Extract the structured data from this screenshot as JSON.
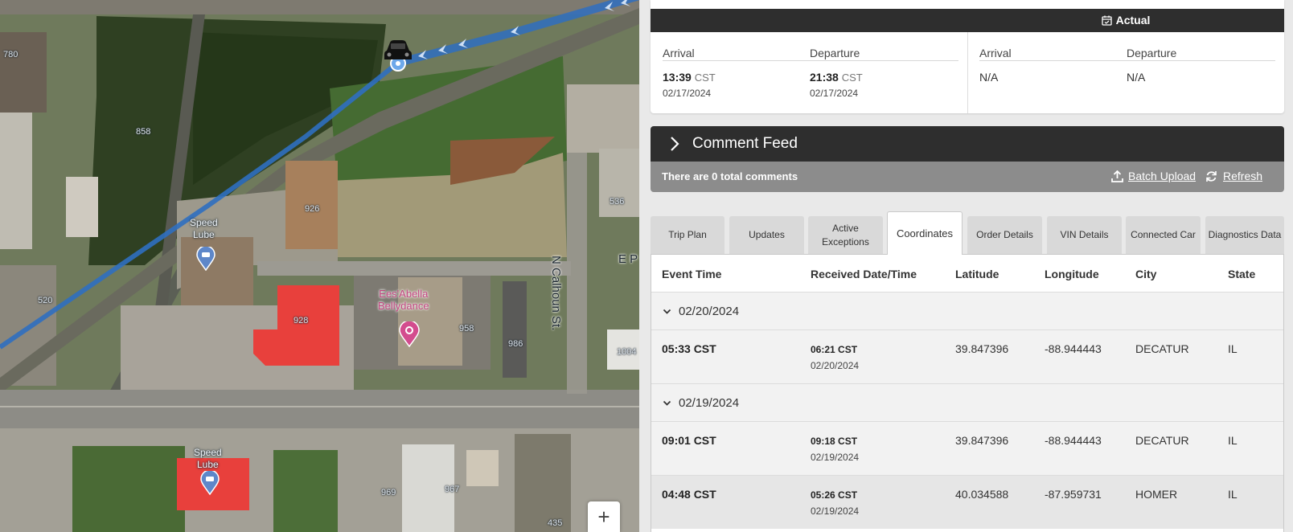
{
  "map": {
    "labels": {
      "speed_lube_1": [
        "Speed",
        "Lube"
      ],
      "speed_lube_2": [
        "Speed",
        "Lube"
      ],
      "bellydance": [
        "Ees'Abella",
        "Bellydance"
      ],
      "street": "N Calhoun St.",
      "edge_street": "E P"
    },
    "addresses": [
      "780",
      "858",
      "926",
      "536",
      "520",
      "928",
      "958",
      "986",
      "1004",
      "969",
      "967",
      "435"
    ],
    "zoom_in": "+",
    "colors": {
      "route": "#2f6fc0",
      "roof_red": "#e8403c",
      "poi_pink": "#d34c8e"
    }
  },
  "times": {
    "actual_title": "Actual",
    "planned": {
      "arrival_label": "Arrival",
      "departure_label": "Departure",
      "arrival_time": "13:39",
      "arrival_tz": "CST",
      "arrival_date": "02/17/2024",
      "departure_time": "21:38",
      "departure_tz": "CST",
      "departure_date": "02/17/2024"
    },
    "actual": {
      "arrival_label": "Arrival",
      "departure_label": "Departure",
      "arrival_value": "N/A",
      "departure_value": "N/A"
    }
  },
  "comments": {
    "title": "Comment Feed",
    "count_text": "There are 0 total comments",
    "batch_upload": "Batch Upload",
    "refresh": "Refresh"
  },
  "tabs": [
    "Trip Plan",
    "Updates",
    "Active Exceptions",
    "Coordinates",
    "Order Details",
    "VIN Details",
    "Connected Car",
    "Diagnostics Data"
  ],
  "active_tab": "Coordinates",
  "table": {
    "headers": [
      "Event Time",
      "Received Date/Time",
      "Latitude",
      "Longitude",
      "City",
      "State"
    ],
    "groups": [
      {
        "date": "02/20/2024",
        "rows": [
          {
            "event": "05:33 CST",
            "recv_time": "06:21 CST",
            "recv_date": "02/20/2024",
            "lat": "39.847396",
            "lon": "-88.944443",
            "city": "DECATUR",
            "state": "IL"
          }
        ]
      },
      {
        "date": "02/19/2024",
        "rows": [
          {
            "event": "09:01 CST",
            "recv_time": "09:18 CST",
            "recv_date": "02/19/2024",
            "lat": "39.847396",
            "lon": "-88.944443",
            "city": "DECATUR",
            "state": "IL"
          },
          {
            "event": "04:48 CST",
            "recv_time": "05:26 CST",
            "recv_date": "02/19/2024",
            "lat": "40.034588",
            "lon": "-87.959731",
            "city": "HOMER",
            "state": "IL"
          }
        ]
      }
    ]
  }
}
